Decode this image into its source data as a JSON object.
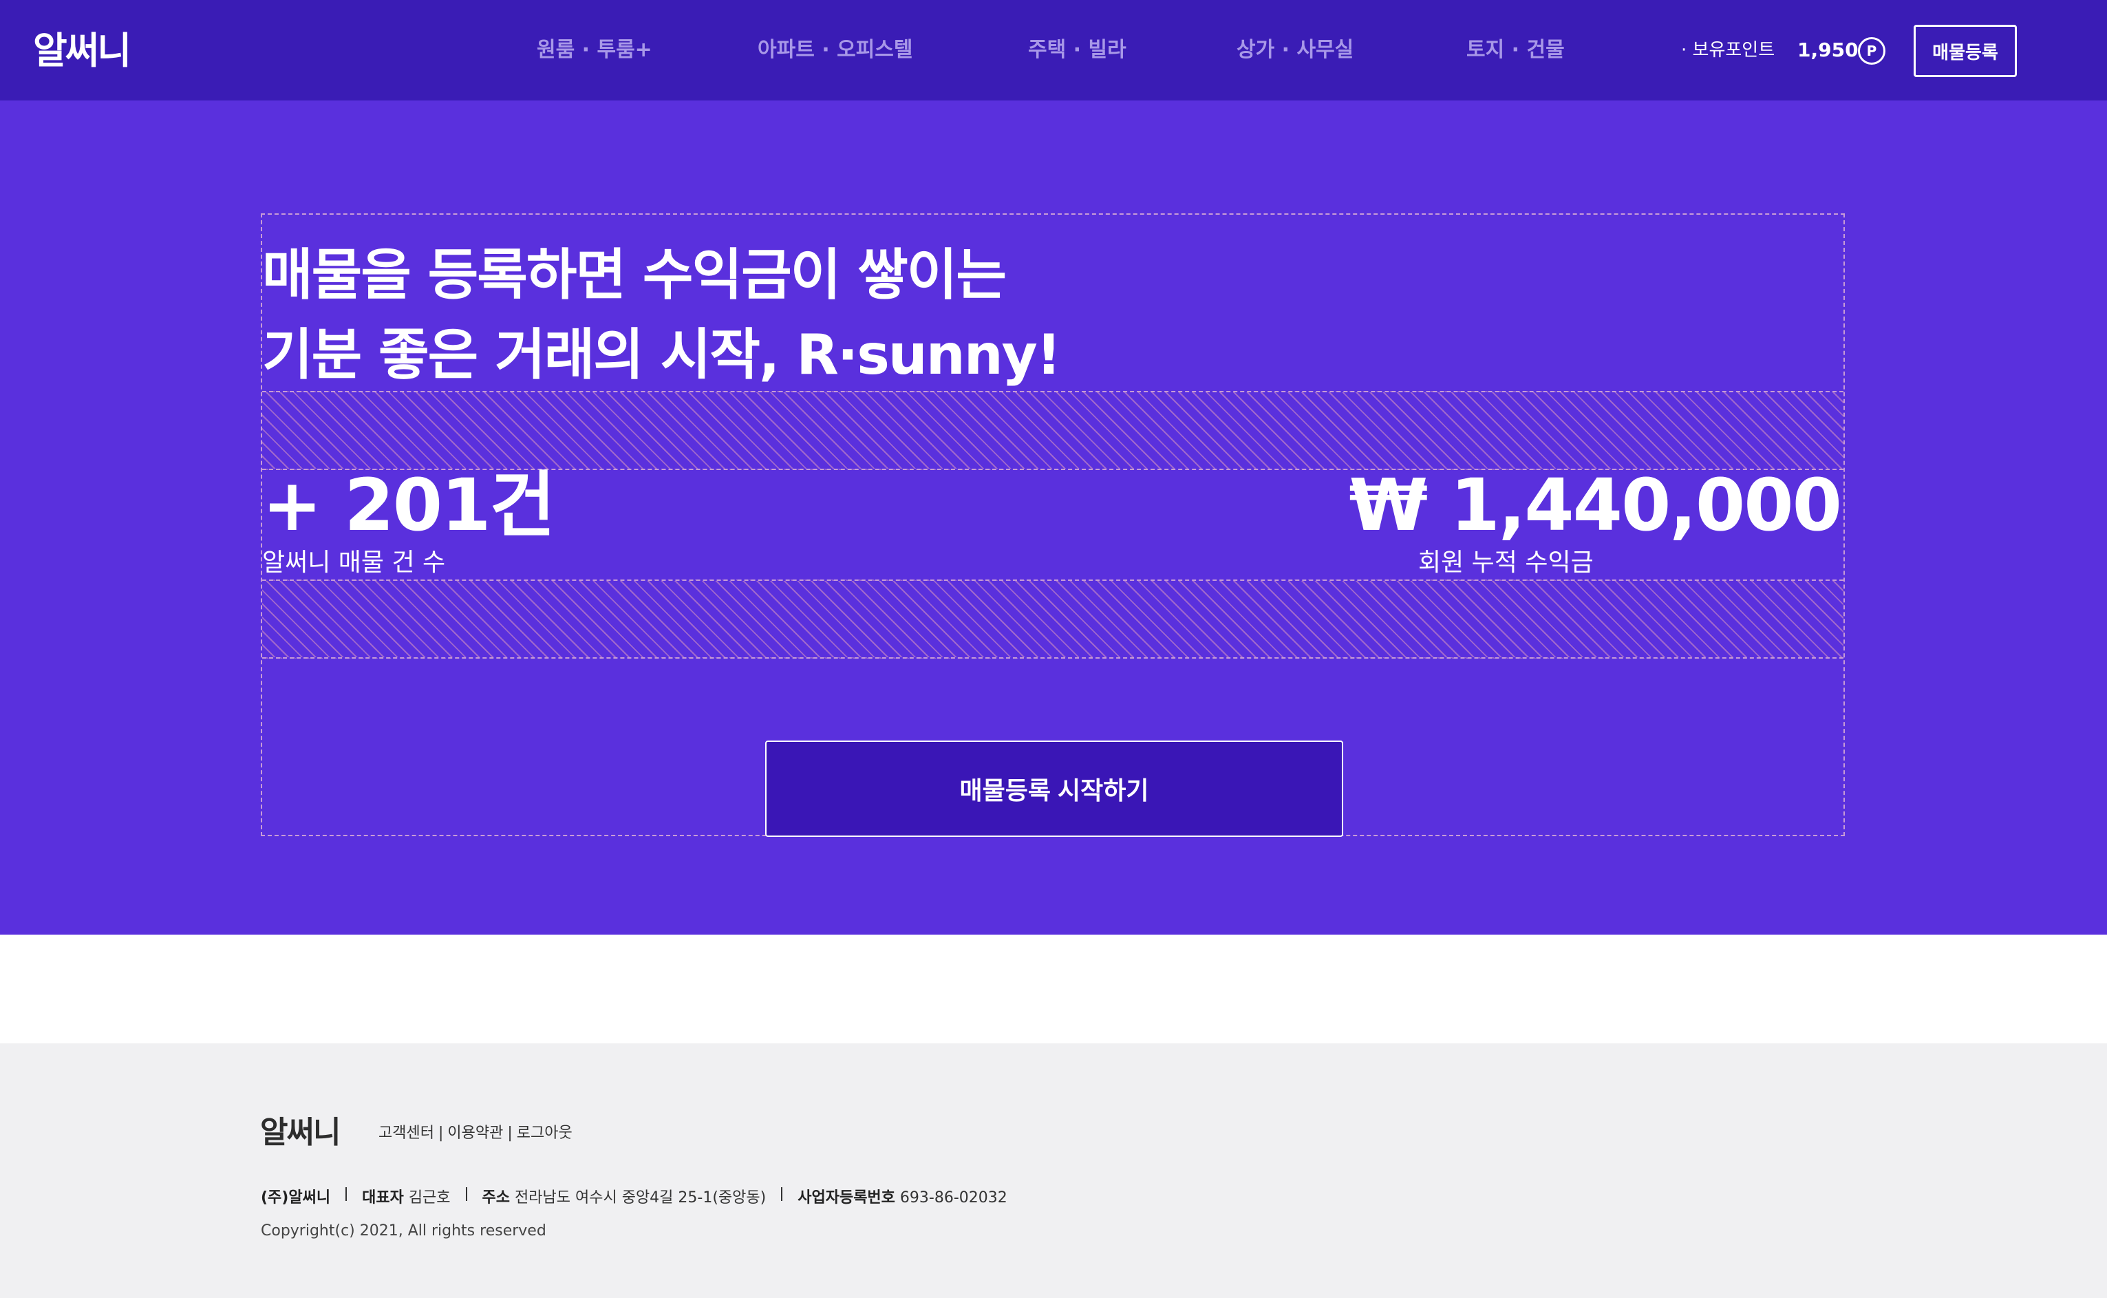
{
  "colors": {
    "header_bg": "#3a1cb5",
    "hero_bg": "#5a30dd",
    "cta_bg": "#3a16b6",
    "nav_text": "#a898e8",
    "footer_bg": "#f0f0f2",
    "guide_dashes": "#c79bd6"
  },
  "header": {
    "logo": "알써니",
    "nav": [
      "원룸 · 투룸+",
      "아파트 · 오피스텔",
      "주택 · 빌라",
      "상가 · 사무실",
      "토지 · 건물"
    ],
    "points_label": "· 보유포인트",
    "points_value": "1,950",
    "points_badge": "P",
    "register_button": "매물등록"
  },
  "hero": {
    "headline_line1": "매물을 등록하면 수익금이 쌓이는",
    "headline_line2": "기분 좋은 거래의 시작, R·sunny!",
    "listing_count": "+ 201건",
    "listing_count_label": "알써니 매물 건 수",
    "earnings": "₩ 1,440,000",
    "earnings_label": "회원 누적 수익금",
    "cta_button": "매물등록 시작하기"
  },
  "footer": {
    "logo": "알써니",
    "links": [
      "고객센터",
      "이용약관",
      "로그아웃"
    ],
    "link_separator": "|",
    "company_name": "(주)알써니",
    "ceo_label": "대표자",
    "ceo_name": "김근호",
    "address_label": "주소",
    "address": "전라남도 여수시 중앙4길 25-1(중앙동)",
    "business_number_label": "사업자등록번호",
    "business_number": "693-86-02032",
    "copyright": "Copyright(c) 2021, All rights reserved"
  }
}
